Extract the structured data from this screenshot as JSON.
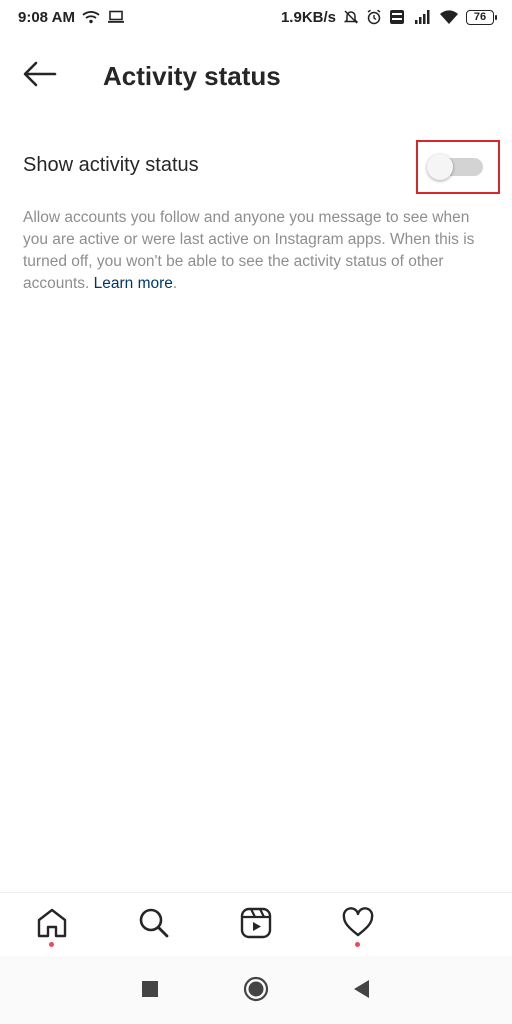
{
  "status_bar": {
    "time": "9:08 AM",
    "network_speed": "1.9KB/s",
    "battery_level": "76",
    "icons": [
      "wifi-icon",
      "laptop-icon",
      "mute-icon",
      "alarm-icon",
      "volte-icon",
      "signal-icon",
      "wifi-icon",
      "battery-icon"
    ]
  },
  "header": {
    "title": "Activity status",
    "back_icon": "arrow-left-icon"
  },
  "setting": {
    "label": "Show activity status",
    "toggle_on": false,
    "highlight_color": "#d9262c"
  },
  "description": {
    "text": "Allow accounts you follow and anyone you message to see when you are active or were last active on Instagram apps. When this is turned off, you won't be able to see the activity status of other accounts.",
    "link_text": "Learn more",
    "link_color": "#00376b"
  },
  "bottom_nav": {
    "items": [
      {
        "icon": "home-icon",
        "has_dot": true
      },
      {
        "icon": "search-icon",
        "has_dot": false
      },
      {
        "icon": "reels-icon",
        "has_dot": false
      },
      {
        "icon": "heart-icon",
        "has_dot": true
      }
    ],
    "dot_color": "#ed4956"
  },
  "system_nav": {
    "items": [
      "recents-square-icon",
      "home-circle-icon",
      "back-triangle-icon"
    ]
  }
}
